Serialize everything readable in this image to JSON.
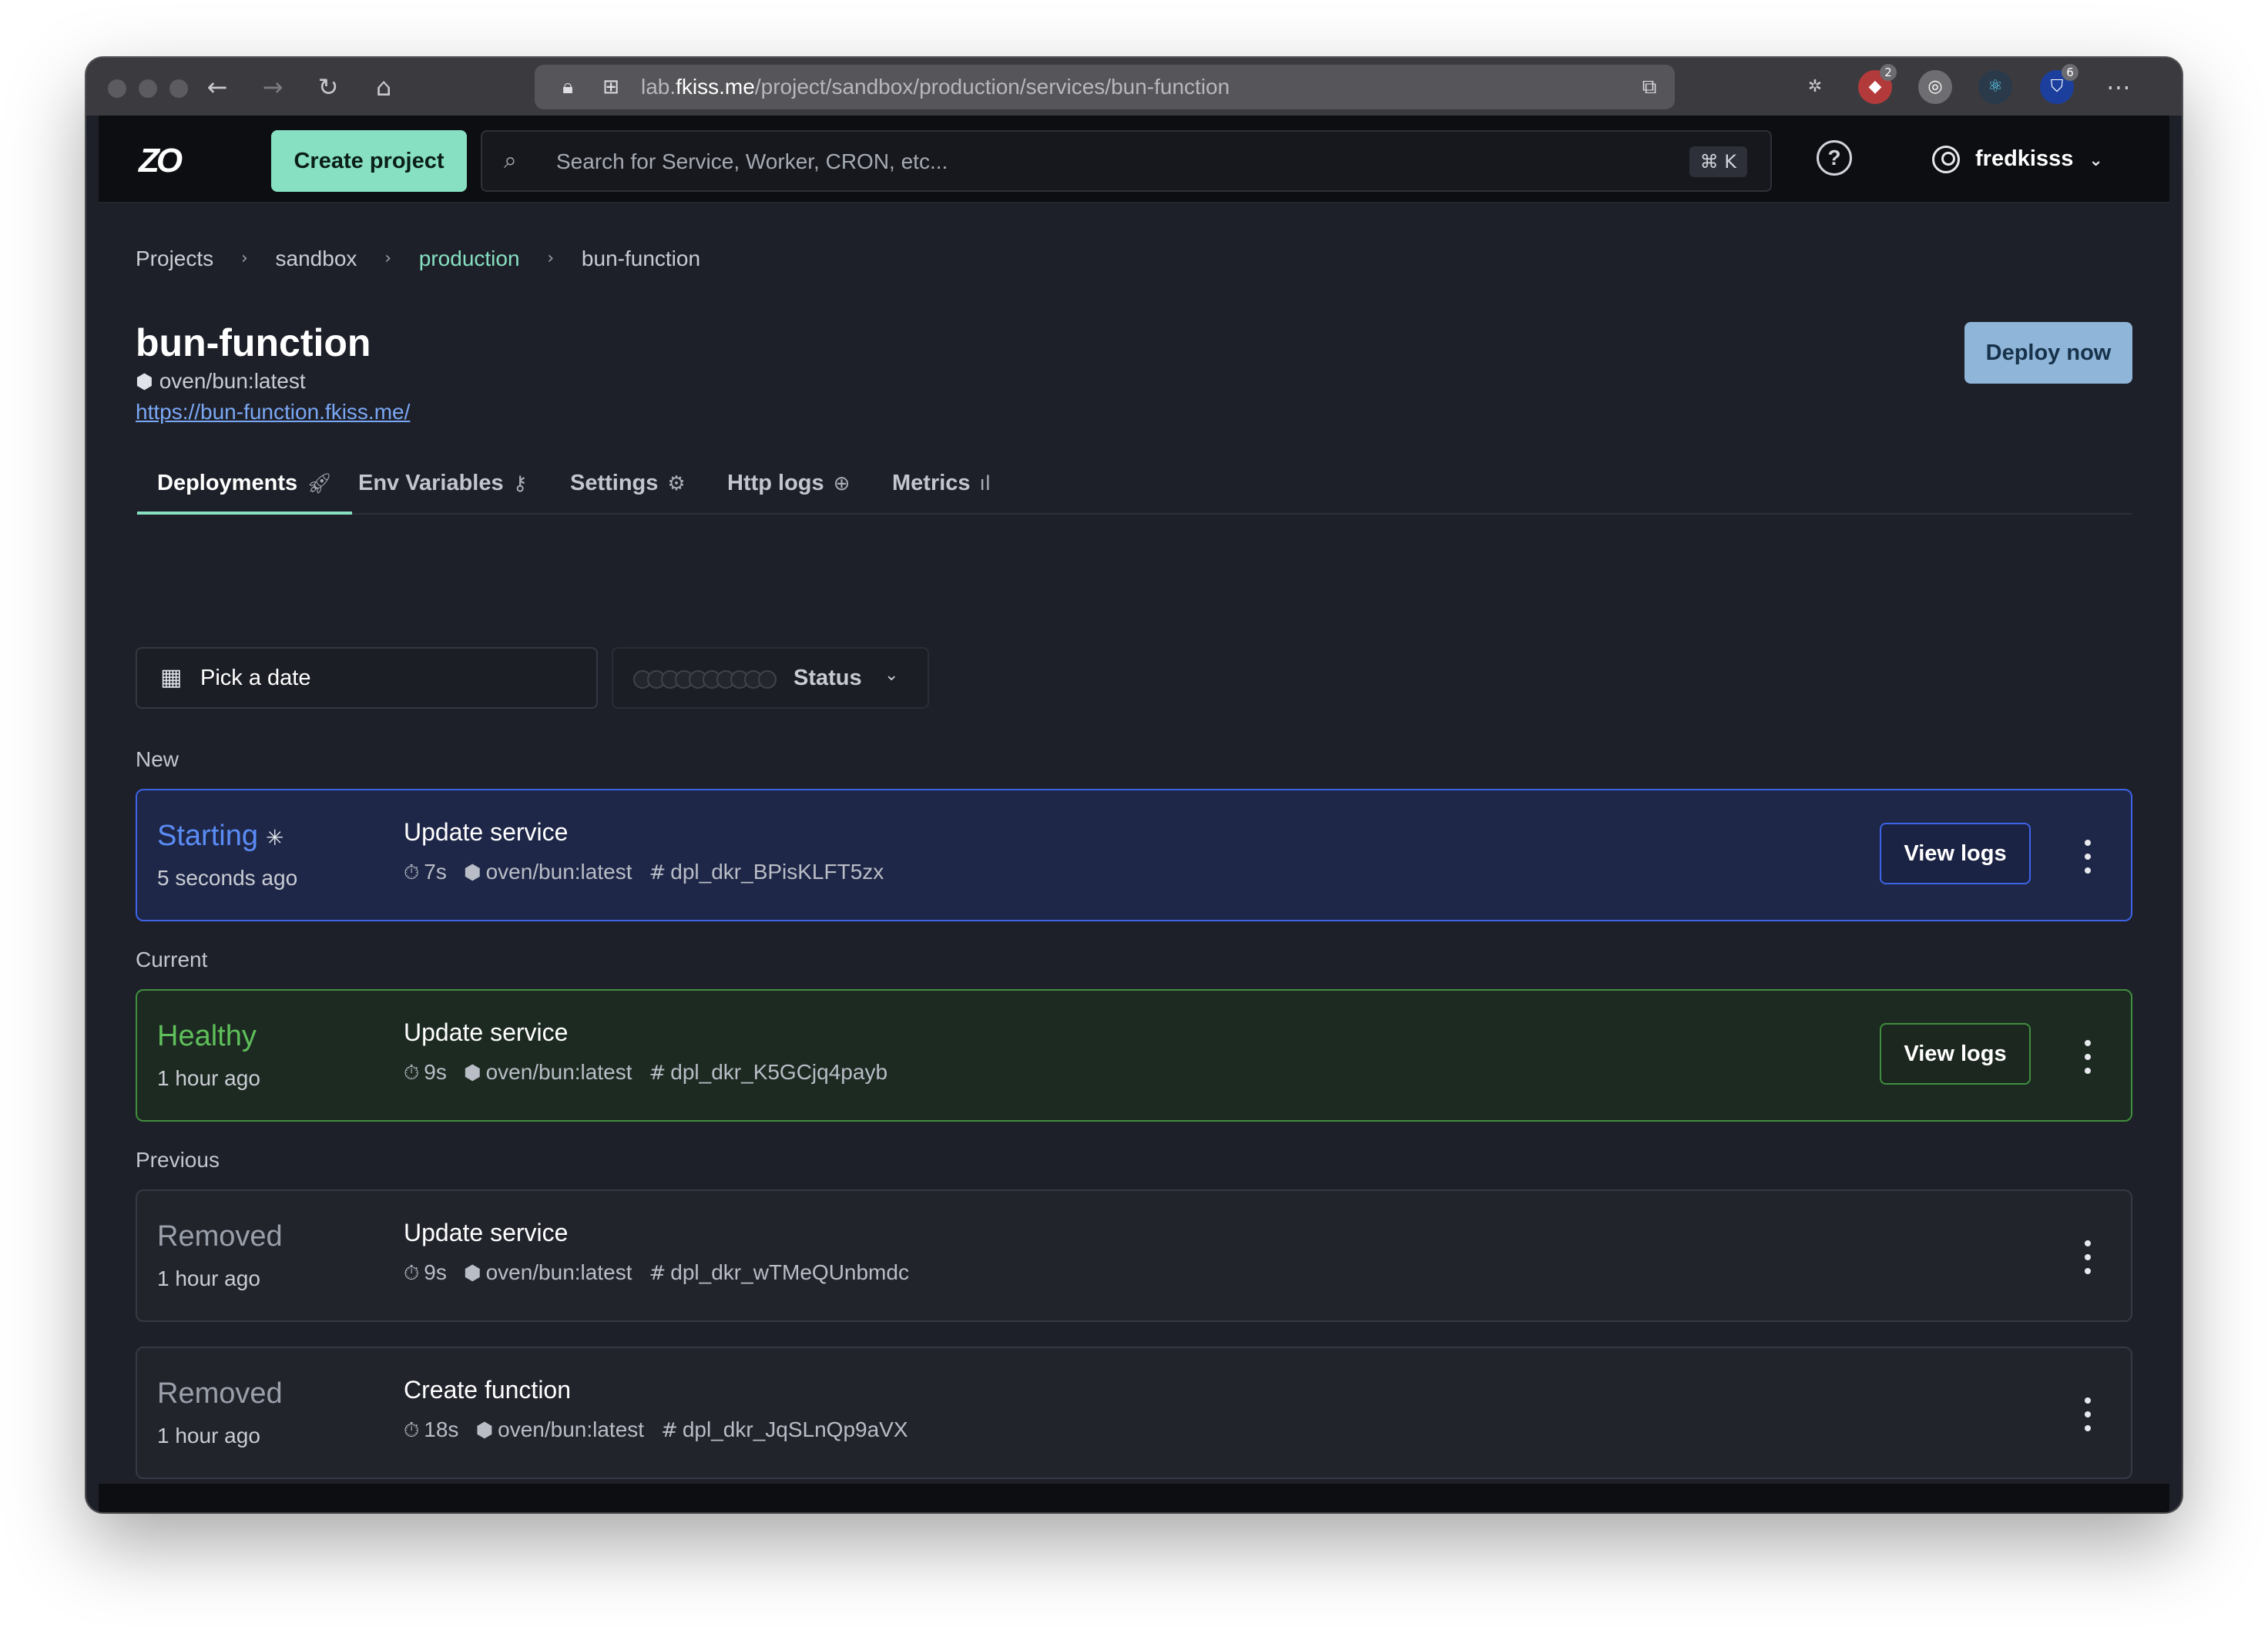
{
  "browser": {
    "url_prefix": "lab.",
    "url_domain": "fkiss.me",
    "url_path": "/project/sandbox/production/services/bun-function",
    "extension_badges": [
      "2",
      "6"
    ]
  },
  "header": {
    "logo": "ZO",
    "create_label": "Create project",
    "search_placeholder": "Search for Service, Worker, CRON, etc...",
    "search_shortcut": "⌘ K",
    "help_label": "?",
    "username": "fredkisss"
  },
  "breadcrumb": [
    "Projects",
    "sandbox",
    "production",
    "bun-function"
  ],
  "service": {
    "name": "bun-function",
    "image": "oven/bun:latest",
    "url": "https://bun-function.fkiss.me/",
    "deploy_label": "Deploy now"
  },
  "tabs": [
    {
      "label": "Deployments",
      "icon": "rocket-icon",
      "active": true
    },
    {
      "label": "Env Variables",
      "icon": "key-icon",
      "active": false
    },
    {
      "label": "Settings",
      "icon": "gear-icon",
      "active": false
    },
    {
      "label": "Http logs",
      "icon": "globe-icon",
      "active": false
    },
    {
      "label": "Metrics",
      "icon": "bar-chart-icon",
      "active": false
    }
  ],
  "filters": {
    "date_label": "Pick a date",
    "status_label": "Status"
  },
  "sections": {
    "new": "New",
    "current": "Current",
    "previous": "Previous"
  },
  "deployments": [
    {
      "status": "Starting",
      "time_ago": "5 seconds ago",
      "message": "Update service",
      "duration": "7s",
      "image": "oven/bun:latest",
      "hash": "dpl_dkr_BPisKLFT5zx",
      "logs_label": "View logs",
      "status_color": "#5a8cf5"
    },
    {
      "status": "Healthy",
      "time_ago": "1 hour ago",
      "message": "Update service",
      "duration": "9s",
      "image": "oven/bun:latest",
      "hash": "dpl_dkr_K5GCjq4payb",
      "logs_label": "View logs",
      "status_color": "#5fbf5a"
    },
    {
      "status": "Removed",
      "time_ago": "1 hour ago",
      "message": "Update service",
      "duration": "9s",
      "image": "oven/bun:latest",
      "hash": "dpl_dkr_wTMeQUnbmdc",
      "status_color": "#9aa0aa"
    },
    {
      "status": "Removed",
      "time_ago": "1 hour ago",
      "message": "Create function",
      "duration": "18s",
      "image": "oven/bun:latest",
      "hash": "dpl_dkr_JqSLnQp9aVX",
      "status_color": "#9aa0aa"
    }
  ]
}
